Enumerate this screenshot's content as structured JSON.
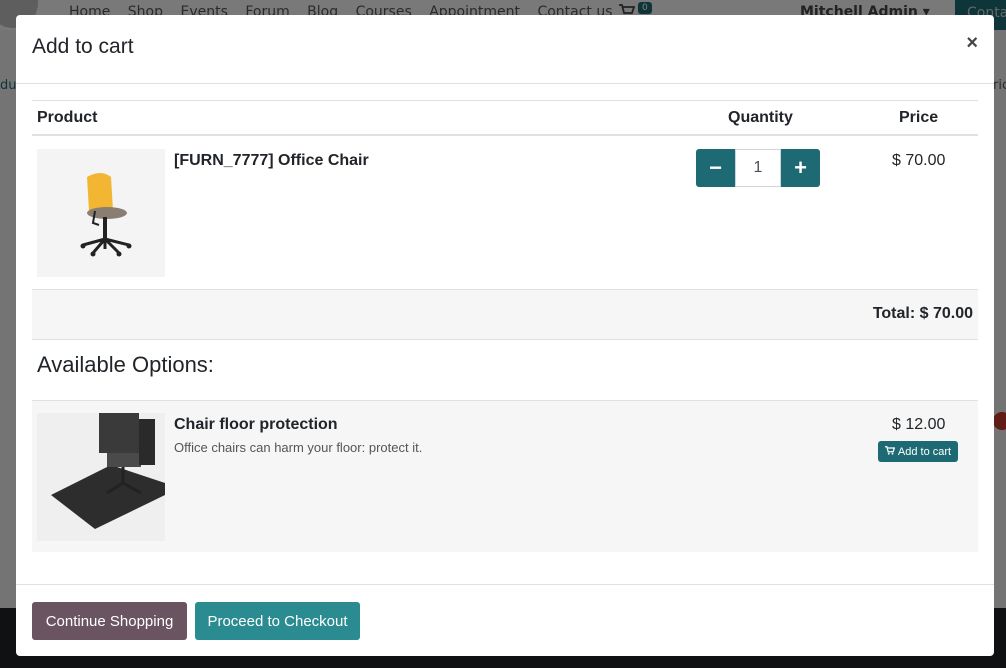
{
  "background": {
    "menu": [
      "Home",
      "Shop",
      "Events",
      "Forum",
      "Blog",
      "Courses",
      "Appointment",
      "Contact us"
    ],
    "cart_count": "0",
    "user": "Mitchell Admin",
    "contact_btn": "Conta",
    "left_fragment": "duc",
    "right_fragment": "ric"
  },
  "modal": {
    "title": "Add to cart",
    "close": "×",
    "headers": {
      "product": "Product",
      "quantity": "Quantity",
      "price": "Price"
    },
    "product": {
      "name": "[FURN_7777] Office Chair",
      "quantity": "1",
      "price": "$ 70.00",
      "minus": "−",
      "plus": "+"
    },
    "total": "Total: $ 70.00",
    "options_title": "Available Options:",
    "option": {
      "name": "Chair floor protection",
      "description": "Office chairs can harm your floor: protect it.",
      "price": "$ 12.00",
      "add_label": "Add to cart"
    },
    "footer": {
      "continue": "Continue Shopping",
      "checkout": "Proceed to Checkout"
    }
  }
}
